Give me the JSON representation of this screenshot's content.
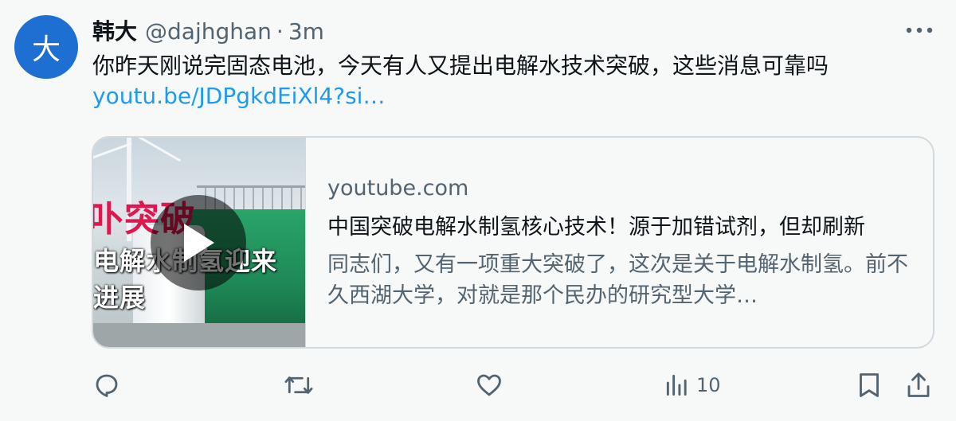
{
  "tweet": {
    "avatar_letter": "大",
    "display_name": "韩大",
    "handle": "@dajhghan",
    "separator": "·",
    "time": "3m",
    "text": "你昨天刚说完固态电池，今天有人又提出电解水技术突破，这些消息可靠吗",
    "link": "youtu.be/JDPgkdEiXl4?si…"
  },
  "card": {
    "thumbnail_overlay": [
      "卟突破",
      "电解水制氢迎来",
      "进展"
    ],
    "domain": "youtube.com",
    "title": "中国突破电解水制氢核心技术！源于加错试剂，但却刷新",
    "description": "同志们，又有一项重大突破了，这次是关于电解水制氢。前不久西湖大学，对就是那个民办的研究型大学…"
  },
  "actions": {
    "views_count": "10",
    "icons": [
      "reply-icon",
      "retweet-icon",
      "like-icon",
      "views-icon",
      "bookmark-icon",
      "share-icon"
    ]
  },
  "colors": {
    "link": "#1d9bf0",
    "avatar": "#1d6fd1",
    "muted": "#536471",
    "text": "#0f1419",
    "border": "#cfd9de"
  }
}
